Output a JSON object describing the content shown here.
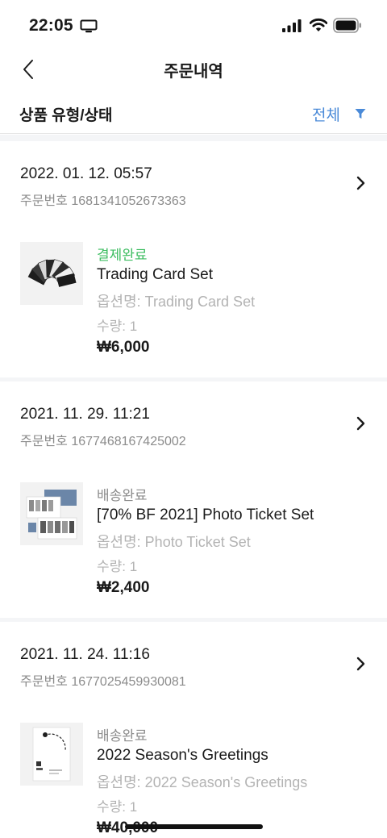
{
  "status_bar": {
    "time": "22:05",
    "icons": [
      "screen-mirroring-icon",
      "cellular-signal-icon",
      "wifi-icon",
      "battery-icon"
    ]
  },
  "nav": {
    "title": "주문내역",
    "back_icon": "chevron-left-icon"
  },
  "filter": {
    "label": "상품 유형/상태",
    "value": "전체",
    "icon": "filter-funnel-icon",
    "accent_color": "#4a8ad8"
  },
  "colors": {
    "status_paid": "#3dbd61",
    "status_shipped": "#8c8c8c",
    "divider_band": "#f4f5f7"
  },
  "orders": [
    {
      "date": "2022. 01. 12. 05:57",
      "order_number": "주문번호 1681341052673363",
      "item": {
        "status": "결제완료",
        "name": "Trading Card Set",
        "option": "옵션명: Trading Card Set",
        "quantity": "수량: 1",
        "price": "₩6,000"
      }
    },
    {
      "date": "2021. 11. 29. 11:21",
      "order_number": "주문번호 1677468167425002",
      "item": {
        "status": "배송완료",
        "name": "[70% BF 2021] Photo Ticket Set",
        "option": "옵션명: Photo Ticket Set",
        "quantity": "수량: 1",
        "price": "₩2,400"
      }
    },
    {
      "date": "2021. 11. 24. 11:16",
      "order_number": "주문번호 1677025459930081",
      "item": {
        "status": "배송완료",
        "name": "2022 Season's Greetings",
        "option": "옵션명: 2022 Season's Greetings",
        "quantity": "수량: 1",
        "price": "₩40,000"
      }
    }
  ]
}
